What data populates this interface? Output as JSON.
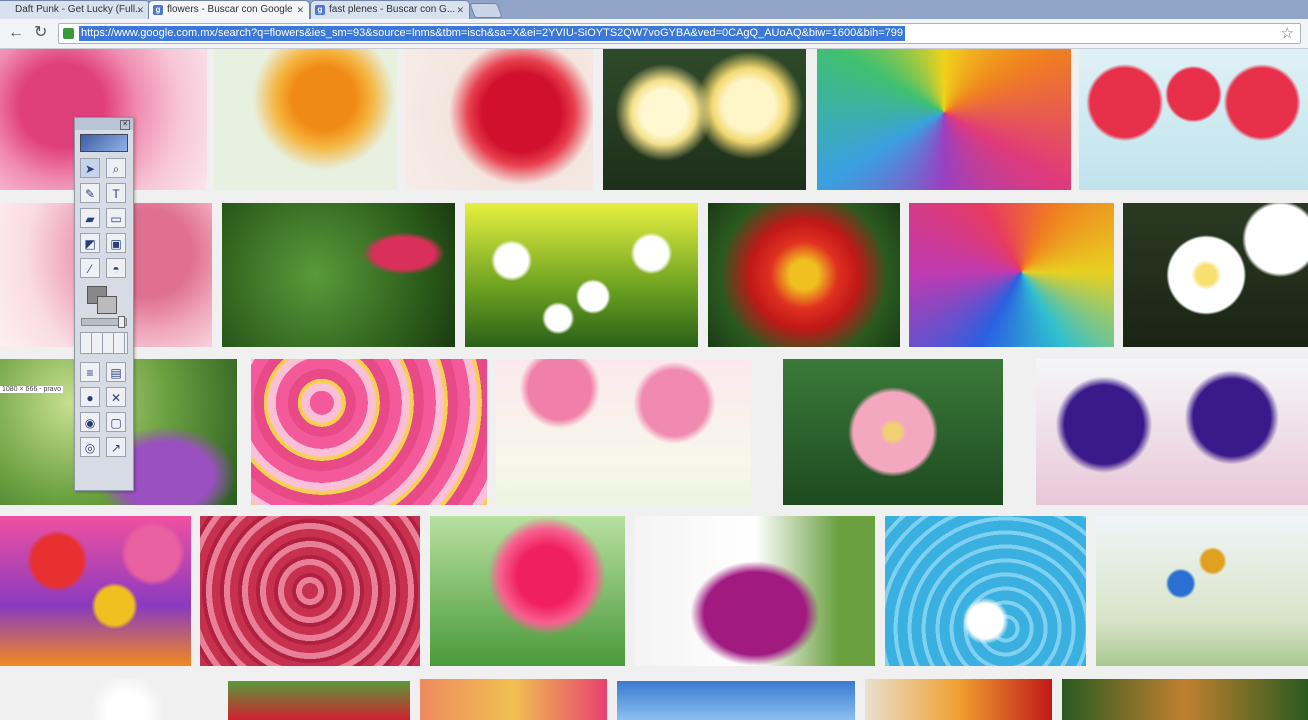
{
  "browser": {
    "tabs": [
      {
        "title": "Daft Punk - Get Lucky (Full...",
        "active": false
      },
      {
        "title": "flowers - Buscar con Google",
        "active": true
      },
      {
        "title": "fast plenes - Buscar con G...",
        "active": false
      }
    ],
    "url": "https://www.google.com.mx/search?q=flowers&ies_sm=93&source=lnms&tbm=isch&sa=X&ei=2YVIU-SiOYTS2QW7voGYBA&ved=0CAgQ_AUoAQ&biw=1600&bih=799"
  },
  "canvas_label": "1080 × 666 - pravo",
  "icons": {
    "tab_favicon": "google-favicon",
    "back": "back-arrow-icon",
    "reload": "reload-icon",
    "lock": "secure-lock-icon",
    "bookmark": "star-icon"
  },
  "palette_tools": [
    "select-arrow-icon",
    "zoom-icon",
    "pencil-icon",
    "text-icon",
    "highlighter-icon",
    "rectangle-icon",
    "eraser-icon",
    "frame-icon",
    "eyedropper-icon",
    "fill-bucket-icon"
  ],
  "palette_tools_bottom": [
    "lines-icon",
    "folder-icon",
    "record-icon",
    "crop-icon",
    "camera-icon",
    "monitor-icon",
    "capture-icon",
    "export-icon"
  ]
}
